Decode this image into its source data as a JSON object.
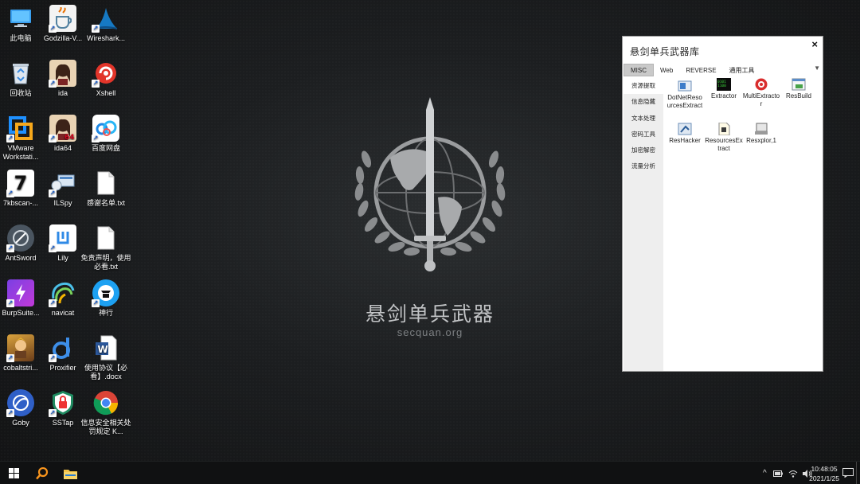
{
  "desktop": {
    "icons": [
      {
        "label": "此电脑",
        "icon": "computer-icon"
      },
      {
        "label": "Godzilla-V...",
        "icon": "java-icon"
      },
      {
        "label": "Wireshark...",
        "icon": "wireshark-fin-icon"
      },
      {
        "label": "回收站",
        "icon": "recycle-bin-icon"
      },
      {
        "label": "ida",
        "icon": "ida-portrait-icon"
      },
      {
        "label": "Xshell",
        "icon": "xshell-icon"
      },
      {
        "label": "VMware Workstati...",
        "icon": "vmware-icon"
      },
      {
        "label": "ida64",
        "icon": "ida64-portrait-icon"
      },
      {
        "label": "百度网盘",
        "icon": "baidu-netdisk-icon"
      },
      {
        "label": "7kbscan-...",
        "icon": "seven-icon"
      },
      {
        "label": "ILSpy",
        "icon": "ilspy-icon"
      },
      {
        "label": "感谢名单.txt",
        "icon": "text-file-icon"
      },
      {
        "label": "AntSword",
        "icon": "antsword-icon"
      },
      {
        "label": "Lily",
        "icon": "lily-icon"
      },
      {
        "label": "免责声明，使用必看.txt",
        "icon": "text-file-icon"
      },
      {
        "label": "BurpSuite...",
        "icon": "burpsuite-icon"
      },
      {
        "label": "navicat",
        "icon": "navicat-icon"
      },
      {
        "label": "神行",
        "icon": "shenxing-icon"
      },
      {
        "label": "cobaltstri...",
        "icon": "cobaltstrike-icon"
      },
      {
        "label": "Proxifier",
        "icon": "proxifier-icon"
      },
      {
        "label": "使用协议【必看】.docx",
        "icon": "word-doc-icon"
      },
      {
        "label": "Goby",
        "icon": "goby-icon"
      },
      {
        "label": "SSTap",
        "icon": "sstap-shield-icon"
      },
      {
        "label": "信息安全相关处罚规定 K...",
        "icon": "chrome-icon"
      }
    ]
  },
  "wallpaper": {
    "title": "悬剑单兵武器",
    "subtitle": "secquan.org"
  },
  "window": {
    "title": "悬剑单兵武器库",
    "close": "×",
    "tabs": [
      {
        "label": "MISC",
        "active": true
      },
      {
        "label": "Web"
      },
      {
        "label": "REVERSE"
      },
      {
        "label": "通用工具"
      }
    ],
    "tab_overflow": "▼",
    "sidebar": [
      "资源提取",
      "信息隐藏",
      "文本处理",
      "密码工具",
      "加密解密",
      "流量分析"
    ],
    "tools": [
      {
        "label": "DotNetResourcesExtract",
        "icon": "dotnet-extract-icon"
      },
      {
        "label": "Extractor",
        "icon": "terminal-icon"
      },
      {
        "label": "MultiExtractor",
        "icon": "multiextractor-icon"
      },
      {
        "label": "ResBuild",
        "icon": "resbuild-icon"
      },
      {
        "label": "ResHacker",
        "icon": "reshacker-icon"
      },
      {
        "label": "ResourcesExtract",
        "icon": "resources-extract-icon"
      },
      {
        "label": "Resxplor,1",
        "icon": "resxplor-icon"
      }
    ]
  },
  "taskbar": {
    "clock_time": "10:48:05",
    "clock_date": "2021/1/25",
    "tray_chevron": "^"
  },
  "colors": {
    "accent_blue": "#1a73e8",
    "tab_active": "#c9c9c9",
    "sidebar_bg": "#eeeeee"
  }
}
